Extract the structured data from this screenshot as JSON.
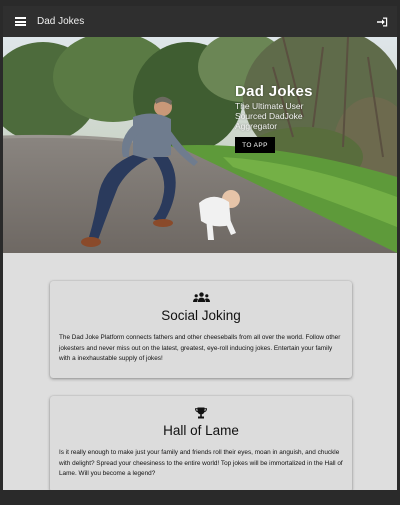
{
  "appbar": {
    "title": "Dad Jokes",
    "menu_icon": "hamburger-menu-icon",
    "login_icon": "login-icon"
  },
  "hero": {
    "title": "Dad Jokes",
    "tagline": "The Ultimate User Sourced DadJoke Aggregator",
    "cta_label": "TO APP"
  },
  "cards": [
    {
      "icon": "users-icon",
      "title": "Social Joking",
      "body": "The Dad Joke Platform connects fathers and other cheeseballs from all over the world. Follow other jokesters and never miss out on the latest, greatest, eye-roll inducing jokes. Entertain your family with a inexhaustable supply of jokes!"
    },
    {
      "icon": "trophy-icon",
      "title": "Hall of Lame",
      "body": "Is it really enough to make just your family and friends roll their eyes, moan in anguish, and chuckle with delight? Spread your cheesiness to the entire world! Top jokes will be immortalized in the Hall of Lame. Will you become a legend?"
    }
  ],
  "colors": {
    "appbar_bg": "#2f2f2f",
    "page_bg": "#dedede",
    "cta_bg": "#000000"
  }
}
